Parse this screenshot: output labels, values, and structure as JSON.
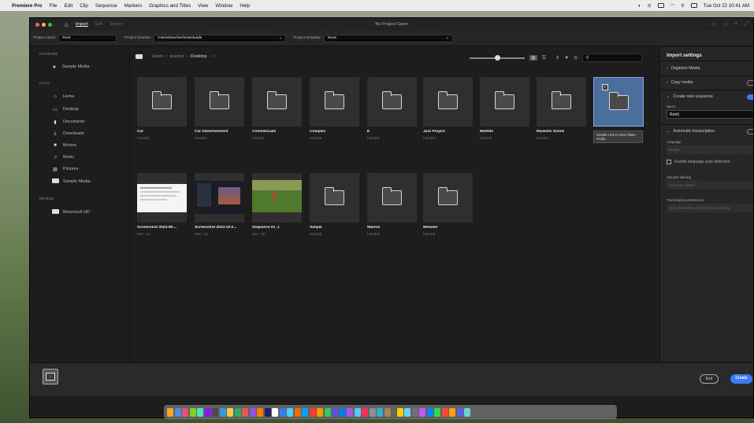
{
  "menubar": {
    "app_name": "Premiere Pro",
    "menus": [
      "File",
      "Edit",
      "Clip",
      "Sequence",
      "Markers",
      "Graphics and Titles",
      "View",
      "Window",
      "Help"
    ],
    "datetime": "Tue Oct 22  10:41 AM"
  },
  "window": {
    "title": "No Project Open",
    "tabs": [
      "Import",
      "Edit",
      "Export"
    ],
    "active_tab": "Import"
  },
  "project_bar": {
    "name_label": "Project name",
    "name_value": "Root",
    "location_label": "Project location",
    "location_value": "/Users/teacher/Downloads",
    "template_label": "Project template",
    "template_value": "None"
  },
  "sidebar": {
    "favorites_header": "FAVORITES",
    "favorites": [
      {
        "label": "Sample Media",
        "icon": "star-icon"
      }
    ],
    "local_header": "LOCAL",
    "local": [
      {
        "label": "Home",
        "icon": "home-icon"
      },
      {
        "label": "Desktop",
        "icon": "desktop-icon"
      },
      {
        "label": "Documents",
        "icon": "document-icon"
      },
      {
        "label": "Downloads",
        "icon": "download-icon"
      },
      {
        "label": "Movies",
        "icon": "movie-icon"
      },
      {
        "label": "Music",
        "icon": "music-icon"
      },
      {
        "label": "Pictures",
        "icon": "picture-icon"
      },
      {
        "label": "Sample Media",
        "icon": "folder-icon"
      }
    ],
    "devices_header": "DEVICES",
    "devices": [
      {
        "label": "Macintosh HD",
        "icon": "drive-icon"
      }
    ]
  },
  "browser": {
    "breadcrumbs": [
      "Users",
      "teacher",
      "Desktop"
    ],
    "search_value": "",
    "zoom_level": 0.45,
    "items": [
      {
        "name": "Car",
        "meta": "FOLDER",
        "type": "folder"
      },
      {
        "name": "Car Advertisement",
        "meta": "FOLDER",
        "type": "folder"
      },
      {
        "name": "Commercials",
        "meta": "FOLDER",
        "type": "folder"
      },
      {
        "name": "Complex",
        "meta": "FOLDER",
        "type": "folder"
      },
      {
        "name": "E",
        "meta": "FOLDER",
        "type": "folder"
      },
      {
        "name": "Jazz Project",
        "meta": "FOLDER",
        "type": "folder"
      },
      {
        "name": "Mattitte",
        "meta": "FOLDER",
        "type": "folder"
      },
      {
        "name": "Realistic Scene",
        "meta": "FOLDER",
        "type": "folder"
      },
      {
        "name": "",
        "meta": "",
        "type": "folder-selected"
      },
      {
        "name": "Screenshot 2024-09-...",
        "meta": "PNG · 1/4",
        "type": "screenshot-light"
      },
      {
        "name": "Screenshot 2024-10-2...",
        "meta": "PNG · 1/4",
        "type": "screenshot-dark"
      },
      {
        "name": "Sequence 01_1",
        "meta": "MP4 · :39",
        "type": "video-field"
      },
      {
        "name": "Simple",
        "meta": "FOLDER",
        "type": "folder"
      },
      {
        "name": "Warhol",
        "meta": "FOLDER",
        "type": "folder"
      },
      {
        "name": "Wheeler",
        "meta": "FOLDER",
        "type": "folder"
      }
    ],
    "tooltip": "Double-click to show folder media"
  },
  "import_settings": {
    "header": "Import settings",
    "organize_media": "Organize Media",
    "copy_media": "Copy media",
    "copy_media_on": false,
    "create_sequence": "Create new sequence",
    "create_sequence_on": true,
    "name_label": "Name",
    "name_value": "Root",
    "auto_transcription": "Automatic transcription",
    "auto_transcription_on": false,
    "language_label": "Language",
    "language_value": "English",
    "auto_detect": "Enable language auto-detection",
    "speaker_label": "Speaker labeling",
    "speaker_value": "Select an option",
    "prefs_label": "Transcription preferences",
    "prefs_value": "Auto-transcribe only clips in sequence"
  },
  "footer": {
    "tray_count": "1",
    "exit_label": "Exit",
    "create_label": "Create"
  },
  "colors": {
    "accent": "#3b7bff",
    "selection": "#4b6f9c"
  }
}
